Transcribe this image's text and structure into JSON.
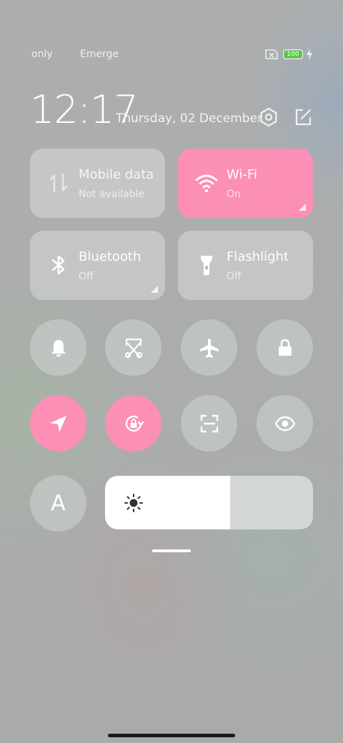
{
  "status_bar": {
    "carrier_1": "only",
    "carrier_2": "Emerge",
    "battery_level": "100",
    "battery_color": "#4fd13b",
    "sim_icon": "no-sim-icon",
    "charging_icon": "charging-bolt-icon"
  },
  "header": {
    "time": "12:17",
    "date": "Thursday, 02 December",
    "settings_icon": "gear-icon",
    "edit_icon": "edit-icon"
  },
  "tiles": [
    {
      "name": "Mobile data",
      "state": "Not available",
      "icon": "mobile-data-icon",
      "active": false
    },
    {
      "name": "Wi-Fi",
      "state": "On",
      "icon": "wifi-icon",
      "active": true
    },
    {
      "name": "Bluetooth",
      "state": "Off",
      "icon": "bluetooth-icon",
      "active": false
    },
    {
      "name": "Flashlight",
      "state": "Off",
      "icon": "flashlight-icon",
      "active": false
    }
  ],
  "toggles_row1": [
    {
      "icon": "bell-icon",
      "active": false
    },
    {
      "icon": "screenshot-icon",
      "active": false
    },
    {
      "icon": "airplane-icon",
      "active": false
    },
    {
      "icon": "lock-icon",
      "active": false
    }
  ],
  "toggles_row2": [
    {
      "icon": "location-icon",
      "active": true
    },
    {
      "icon": "rotation-lock-icon",
      "active": true
    },
    {
      "icon": "scan-icon",
      "active": false
    },
    {
      "icon": "eye-icon",
      "active": false
    }
  ],
  "font_button": {
    "label": "A"
  },
  "brightness": {
    "level": 0.6,
    "icon": "sun-icon"
  },
  "accent_color": "#fb8fb5"
}
